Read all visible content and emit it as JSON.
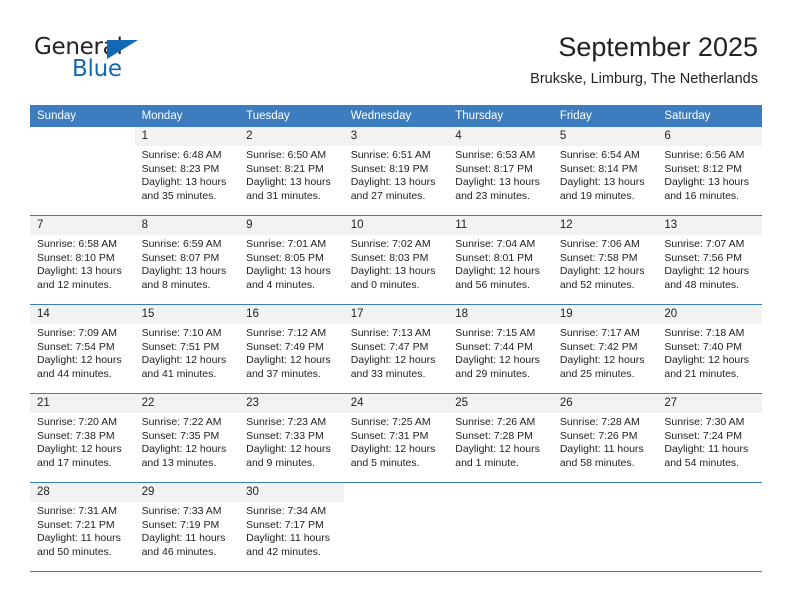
{
  "brand": {
    "name_top": "General",
    "name_bottom": "Blue",
    "triangle_color": "#1268b3"
  },
  "header": {
    "title": "September 2025",
    "subtitle": "Brukske, Limburg, The Netherlands"
  },
  "theme": {
    "header_row_bg": "#3d7cbf",
    "daynum_bg": "#f2f2f2",
    "text": "#222222"
  },
  "weekday_headers": [
    "Sunday",
    "Monday",
    "Tuesday",
    "Wednesday",
    "Thursday",
    "Friday",
    "Saturday"
  ],
  "weeks": [
    [
      {
        "day": "",
        "sunrise": "",
        "sunset": "",
        "daylight1": "",
        "daylight2": ""
      },
      {
        "day": "1",
        "sunrise": "Sunrise: 6:48 AM",
        "sunset": "Sunset: 8:23 PM",
        "daylight1": "Daylight: 13 hours",
        "daylight2": "and 35 minutes."
      },
      {
        "day": "2",
        "sunrise": "Sunrise: 6:50 AM",
        "sunset": "Sunset: 8:21 PM",
        "daylight1": "Daylight: 13 hours",
        "daylight2": "and 31 minutes."
      },
      {
        "day": "3",
        "sunrise": "Sunrise: 6:51 AM",
        "sunset": "Sunset: 8:19 PM",
        "daylight1": "Daylight: 13 hours",
        "daylight2": "and 27 minutes."
      },
      {
        "day": "4",
        "sunrise": "Sunrise: 6:53 AM",
        "sunset": "Sunset: 8:17 PM",
        "daylight1": "Daylight: 13 hours",
        "daylight2": "and 23 minutes."
      },
      {
        "day": "5",
        "sunrise": "Sunrise: 6:54 AM",
        "sunset": "Sunset: 8:14 PM",
        "daylight1": "Daylight: 13 hours",
        "daylight2": "and 19 minutes."
      },
      {
        "day": "6",
        "sunrise": "Sunrise: 6:56 AM",
        "sunset": "Sunset: 8:12 PM",
        "daylight1": "Daylight: 13 hours",
        "daylight2": "and 16 minutes."
      }
    ],
    [
      {
        "day": "7",
        "sunrise": "Sunrise: 6:58 AM",
        "sunset": "Sunset: 8:10 PM",
        "daylight1": "Daylight: 13 hours",
        "daylight2": "and 12 minutes."
      },
      {
        "day": "8",
        "sunrise": "Sunrise: 6:59 AM",
        "sunset": "Sunset: 8:07 PM",
        "daylight1": "Daylight: 13 hours",
        "daylight2": "and 8 minutes."
      },
      {
        "day": "9",
        "sunrise": "Sunrise: 7:01 AM",
        "sunset": "Sunset: 8:05 PM",
        "daylight1": "Daylight: 13 hours",
        "daylight2": "and 4 minutes."
      },
      {
        "day": "10",
        "sunrise": "Sunrise: 7:02 AM",
        "sunset": "Sunset: 8:03 PM",
        "daylight1": "Daylight: 13 hours",
        "daylight2": "and 0 minutes."
      },
      {
        "day": "11",
        "sunrise": "Sunrise: 7:04 AM",
        "sunset": "Sunset: 8:01 PM",
        "daylight1": "Daylight: 12 hours",
        "daylight2": "and 56 minutes."
      },
      {
        "day": "12",
        "sunrise": "Sunrise: 7:06 AM",
        "sunset": "Sunset: 7:58 PM",
        "daylight1": "Daylight: 12 hours",
        "daylight2": "and 52 minutes."
      },
      {
        "day": "13",
        "sunrise": "Sunrise: 7:07 AM",
        "sunset": "Sunset: 7:56 PM",
        "daylight1": "Daylight: 12 hours",
        "daylight2": "and 48 minutes."
      }
    ],
    [
      {
        "day": "14",
        "sunrise": "Sunrise: 7:09 AM",
        "sunset": "Sunset: 7:54 PM",
        "daylight1": "Daylight: 12 hours",
        "daylight2": "and 44 minutes."
      },
      {
        "day": "15",
        "sunrise": "Sunrise: 7:10 AM",
        "sunset": "Sunset: 7:51 PM",
        "daylight1": "Daylight: 12 hours",
        "daylight2": "and 41 minutes."
      },
      {
        "day": "16",
        "sunrise": "Sunrise: 7:12 AM",
        "sunset": "Sunset: 7:49 PM",
        "daylight1": "Daylight: 12 hours",
        "daylight2": "and 37 minutes."
      },
      {
        "day": "17",
        "sunrise": "Sunrise: 7:13 AM",
        "sunset": "Sunset: 7:47 PM",
        "daylight1": "Daylight: 12 hours",
        "daylight2": "and 33 minutes."
      },
      {
        "day": "18",
        "sunrise": "Sunrise: 7:15 AM",
        "sunset": "Sunset: 7:44 PM",
        "daylight1": "Daylight: 12 hours",
        "daylight2": "and 29 minutes."
      },
      {
        "day": "19",
        "sunrise": "Sunrise: 7:17 AM",
        "sunset": "Sunset: 7:42 PM",
        "daylight1": "Daylight: 12 hours",
        "daylight2": "and 25 minutes."
      },
      {
        "day": "20",
        "sunrise": "Sunrise: 7:18 AM",
        "sunset": "Sunset: 7:40 PM",
        "daylight1": "Daylight: 12 hours",
        "daylight2": "and 21 minutes."
      }
    ],
    [
      {
        "day": "21",
        "sunrise": "Sunrise: 7:20 AM",
        "sunset": "Sunset: 7:38 PM",
        "daylight1": "Daylight: 12 hours",
        "daylight2": "and 17 minutes."
      },
      {
        "day": "22",
        "sunrise": "Sunrise: 7:22 AM",
        "sunset": "Sunset: 7:35 PM",
        "daylight1": "Daylight: 12 hours",
        "daylight2": "and 13 minutes."
      },
      {
        "day": "23",
        "sunrise": "Sunrise: 7:23 AM",
        "sunset": "Sunset: 7:33 PM",
        "daylight1": "Daylight: 12 hours",
        "daylight2": "and 9 minutes."
      },
      {
        "day": "24",
        "sunrise": "Sunrise: 7:25 AM",
        "sunset": "Sunset: 7:31 PM",
        "daylight1": "Daylight: 12 hours",
        "daylight2": "and 5 minutes."
      },
      {
        "day": "25",
        "sunrise": "Sunrise: 7:26 AM",
        "sunset": "Sunset: 7:28 PM",
        "daylight1": "Daylight: 12 hours",
        "daylight2": "and 1 minute."
      },
      {
        "day": "26",
        "sunrise": "Sunrise: 7:28 AM",
        "sunset": "Sunset: 7:26 PM",
        "daylight1": "Daylight: 11 hours",
        "daylight2": "and 58 minutes."
      },
      {
        "day": "27",
        "sunrise": "Sunrise: 7:30 AM",
        "sunset": "Sunset: 7:24 PM",
        "daylight1": "Daylight: 11 hours",
        "daylight2": "and 54 minutes."
      }
    ],
    [
      {
        "day": "28",
        "sunrise": "Sunrise: 7:31 AM",
        "sunset": "Sunset: 7:21 PM",
        "daylight1": "Daylight: 11 hours",
        "daylight2": "and 50 minutes."
      },
      {
        "day": "29",
        "sunrise": "Sunrise: 7:33 AM",
        "sunset": "Sunset: 7:19 PM",
        "daylight1": "Daylight: 11 hours",
        "daylight2": "and 46 minutes."
      },
      {
        "day": "30",
        "sunrise": "Sunrise: 7:34 AM",
        "sunset": "Sunset: 7:17 PM",
        "daylight1": "Daylight: 11 hours",
        "daylight2": "and 42 minutes."
      },
      {
        "day": "",
        "sunrise": "",
        "sunset": "",
        "daylight1": "",
        "daylight2": ""
      },
      {
        "day": "",
        "sunrise": "",
        "sunset": "",
        "daylight1": "",
        "daylight2": ""
      },
      {
        "day": "",
        "sunrise": "",
        "sunset": "",
        "daylight1": "",
        "daylight2": ""
      },
      {
        "day": "",
        "sunrise": "",
        "sunset": "",
        "daylight1": "",
        "daylight2": ""
      }
    ]
  ]
}
